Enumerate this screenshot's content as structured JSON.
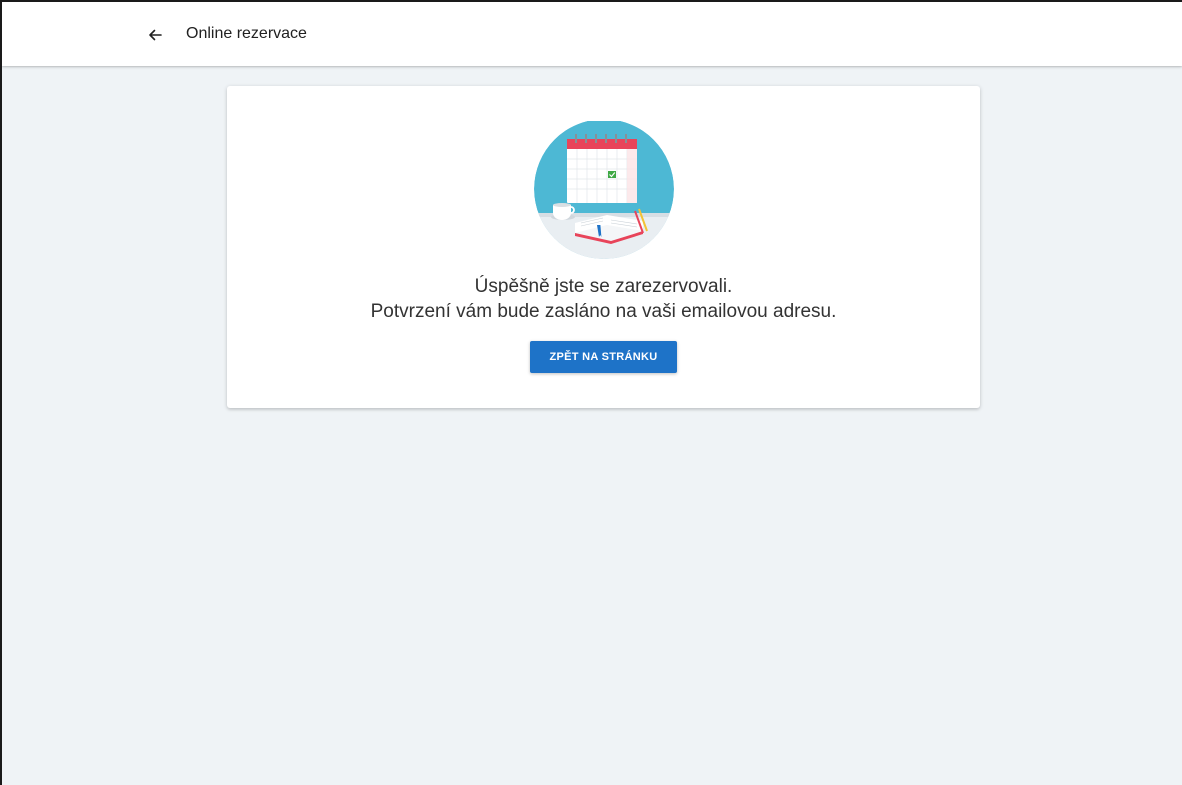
{
  "header": {
    "back_icon": "arrow-left-icon",
    "title": "Online rezervace"
  },
  "confirmation": {
    "illustration": "calendar-booking-illustration",
    "message_line_1": "Úspěšně jste se zarezervovali.",
    "message_line_2": "Potvrzení vám bude zasláno na vaši emailovou adresu.",
    "button_label": "ZPĚT NA STRÁNKU"
  },
  "colors": {
    "background": "#eff3f6",
    "appbar": "#ffffff",
    "card": "#ffffff",
    "primary_button": "#1e73c8",
    "illustration_circle": "#4db8d4",
    "calendar_header": "#e8445a",
    "check_mark": "#3fa845"
  }
}
